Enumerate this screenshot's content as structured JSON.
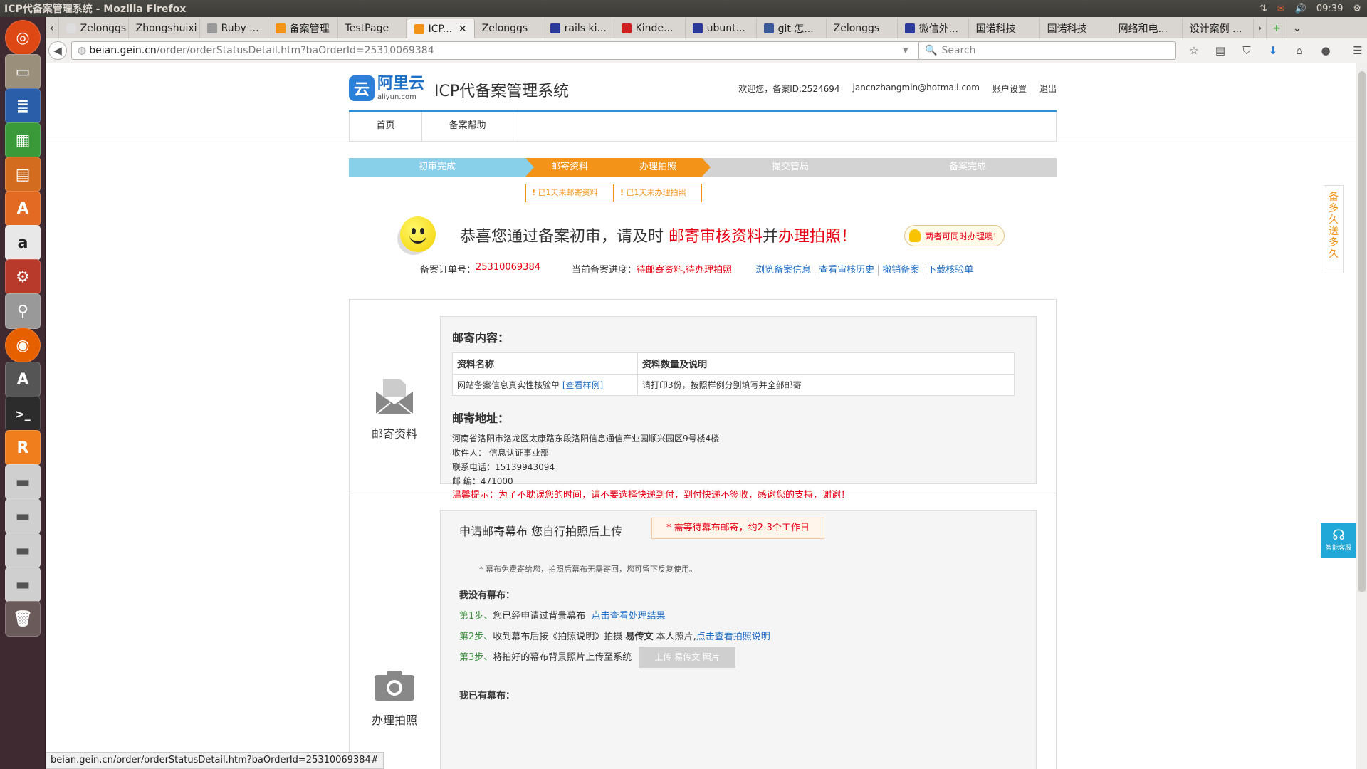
{
  "os": {
    "window_title": "ICP代备案管理系统 - Mozilla Firefox",
    "clock": "09:39"
  },
  "browser": {
    "tabs": [
      {
        "label": "Zelonggs"
      },
      {
        "label": "Zhongshuixi"
      },
      {
        "label": "Ruby ..."
      },
      {
        "label": "备案管理"
      },
      {
        "label": "TestPage"
      },
      {
        "label": "ICP..."
      },
      {
        "label": "Zelonggs"
      },
      {
        "label": "rails ki..."
      },
      {
        "label": "Kinde..."
      },
      {
        "label": "ubunt..."
      },
      {
        "label": "git 怎..."
      },
      {
        "label": "Zelonggs"
      },
      {
        "label": "微信外..."
      },
      {
        "label": "国诺科技"
      },
      {
        "label": "国诺科技"
      },
      {
        "label": "网络和电..."
      },
      {
        "label": "设计案例 ..."
      }
    ],
    "url_host": "beian.gein.cn",
    "url_path": "/order/orderStatusDetail.htm?baOrderId=25310069384",
    "search_placeholder": "Search",
    "status_url": "beian.gein.cn/order/orderStatusDetail.htm?baOrderId=25310069384#"
  },
  "header": {
    "logo_cn": "阿里云",
    "logo_en": "aliyun.com",
    "system_title": "ICP代备案管理系统",
    "welcome": "欢迎您，备案ID:2524694",
    "email": "jancnzhangmin@hotmail.com",
    "account_settings": "账户设置",
    "logout": "退出",
    "menu": [
      "首页",
      "备案帮助"
    ]
  },
  "steps": {
    "items": [
      "初审完成",
      "邮寄资料",
      "办理拍照",
      "提交管局",
      "备案完成"
    ],
    "warn_mail": "已1天未邮寄资料",
    "warn_photo": "已1天未办理拍照"
  },
  "congrats": {
    "prefix": "恭喜您通过备案初审，请及时 ",
    "hl1": "邮寄审核资料",
    "mid": "并",
    "hl2": "办理拍照！",
    "tip": "两者可同时办理噢!"
  },
  "order": {
    "number_label": "备案订单号：",
    "number": "25310069384",
    "progress_label": "当前备案进度：",
    "progress": "待邮寄资料,待办理拍照",
    "links": [
      "浏览备案信息",
      "查看审核历史",
      "撤销备案",
      "下载核验单"
    ]
  },
  "mail_section": {
    "side_label": "邮寄资料",
    "content_title": "邮寄内容：",
    "col_name": "资料名称",
    "col_desc": "资料数量及说明",
    "row_name": "网站备案信息真实性核验单",
    "row_link": "[查看样例]",
    "row_desc": "请打印3份，按照样例分别填写并全部邮寄",
    "address_title": "邮寄地址：",
    "address": "河南省洛阳市洛龙区太康路东段洛阳信息通信产业园顺兴园区9号楼4楼",
    "recipient": "收件人： 信息认证事业部",
    "phone": "联系电话：15139943094",
    "postcode": "邮 编：471000",
    "warm_tip": "温馨提示：为了不耽误您的时间，请不要选择快递到付，到付快递不签收，感谢您的支持，谢谢！"
  },
  "photo_section": {
    "side_label": "办理拍照",
    "title": "申请邮寄幕布 您自行拍照后上传",
    "need_tip": "* 需等待幕布邮寄，约2-3个工作日",
    "note": "* 幕布免费寄给您，拍照后幕布无需寄回，您可留下反复使用。",
    "no_curtain": "我没有幕布：",
    "step1_num": "第1步、",
    "step1": "您已经申请过背景幕布",
    "step1_link": "点击查看处理结果",
    "step2_num": "第2步、",
    "step2_a": "收到幕布后按《拍照说明》拍摄",
    "step2_name": "易传文",
    "step2_b": "本人照片,",
    "step2_link": "点击查看拍照说明",
    "step3_num": "第3步、",
    "step3": "将拍好的幕布背景照片上传至系统",
    "upload_btn": "上传 易传文 照片",
    "have_curtain": "我已有幕布："
  },
  "floats": {
    "right_tab": "备多久送多久",
    "service": "智能客服"
  }
}
